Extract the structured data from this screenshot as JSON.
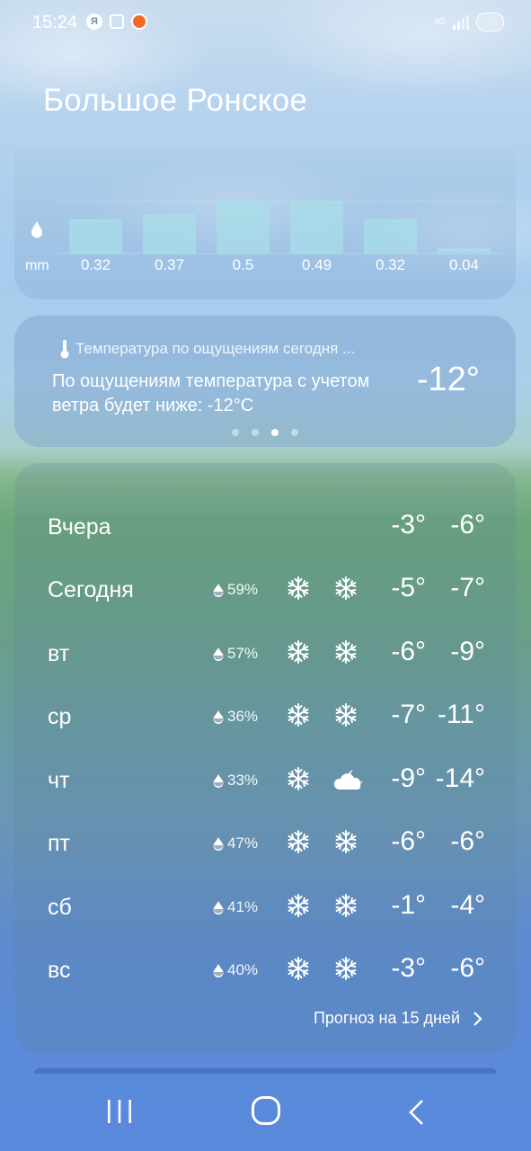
{
  "status_bar": {
    "time": "15:24",
    "ya_label": "Я",
    "network": "4G",
    "battery": "78"
  },
  "city": "Большое Ронское",
  "precipitation": {
    "unit": "mm",
    "values": [
      "0.32",
      "0.37",
      "0.5",
      "0.49",
      "0.32",
      "0.04"
    ]
  },
  "feels_like": {
    "heading": "Температура по ощущениям сегодня ...",
    "text": "По ощущениям температура с учетом ветра будет ниже: -12°C",
    "value": "-12°",
    "page_count": 4,
    "active_page": 3
  },
  "forecast": {
    "rows": [
      {
        "day": "Вчера",
        "precip": "",
        "icon_day": "",
        "icon_night": "",
        "high": "-3°",
        "low": "-6°"
      },
      {
        "day": "Сегодня",
        "precip": "59%",
        "icon_day": "snowflake-icon",
        "icon_night": "snowflake-icon",
        "high": "-5°",
        "low": "-7°"
      },
      {
        "day": "вт",
        "precip": "57%",
        "icon_day": "snowflake-icon",
        "icon_night": "snowflake-icon",
        "high": "-6°",
        "low": "-9°"
      },
      {
        "day": "ср",
        "precip": "36%",
        "icon_day": "snowflake-icon",
        "icon_night": "snowflake-icon",
        "high": "-7°",
        "low": "-11°"
      },
      {
        "day": "чт",
        "precip": "33%",
        "icon_day": "snowflake-icon",
        "icon_night": "cloud-moon-icon",
        "high": "-9°",
        "low": "-14°"
      },
      {
        "day": "пт",
        "precip": "47%",
        "icon_day": "snowflake-icon",
        "icon_night": "snowflake-icon",
        "high": "-6°",
        "low": "-6°"
      },
      {
        "day": "сб",
        "precip": "41%",
        "icon_day": "snowflake-icon",
        "icon_night": "snowflake-icon",
        "high": "-1°",
        "low": "-4°"
      },
      {
        "day": "вс",
        "precip": "40%",
        "icon_day": "snowflake-icon",
        "icon_night": "snowflake-icon",
        "high": "-3°",
        "low": "-6°"
      }
    ],
    "more_label": "Прогноз на 15 дней"
  },
  "colors": {
    "text": "#ffffff",
    "bar_fill": "#a8dde8"
  }
}
